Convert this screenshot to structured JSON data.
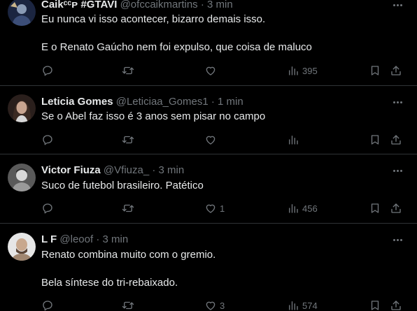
{
  "tweets": [
    {
      "name": "Caikᶜᶜᴘ #GTAVI",
      "handle": "@ofccaikmartins",
      "dot": "·",
      "time": "3 min",
      "lines": [
        "Eu nunca vi isso acontecer, bizarro demais isso.",
        "E o Renato Gaúcho nem foi expulso, que coisa de maluco"
      ],
      "likes": "",
      "views": "395",
      "avatar_colors": [
        "#8a9bb5",
        "#3c4e78"
      ]
    },
    {
      "name": "Leticia Gomes",
      "handle": "@Leticiaa_Gomes1",
      "dot": "·",
      "time": "1 min",
      "lines": [
        "Se o Abel faz isso é 3 anos sem pisar no campo"
      ],
      "likes": "",
      "views": "",
      "avatar_colors": [
        "#c9a590",
        "#2a1f1c"
      ]
    },
    {
      "name": "Victor Fiuza",
      "handle": "@Vfiuza_",
      "dot": "·",
      "time": "3 min",
      "lines": [
        "Suco de futebol brasileiro. Patético"
      ],
      "likes": "1",
      "views": "456",
      "avatar_colors": [
        "#d8d8d8",
        "#5a5a5a"
      ]
    },
    {
      "name": "L F",
      "handle": "@leoof",
      "dot": "·",
      "time": "3 min",
      "lines": [
        "Renato combina muito com o gremio.",
        "Bela síntese do tri-rebaixado."
      ],
      "likes": "3",
      "views": "574",
      "avatar_colors": [
        "#d9d9d9",
        "#a08670"
      ]
    }
  ]
}
